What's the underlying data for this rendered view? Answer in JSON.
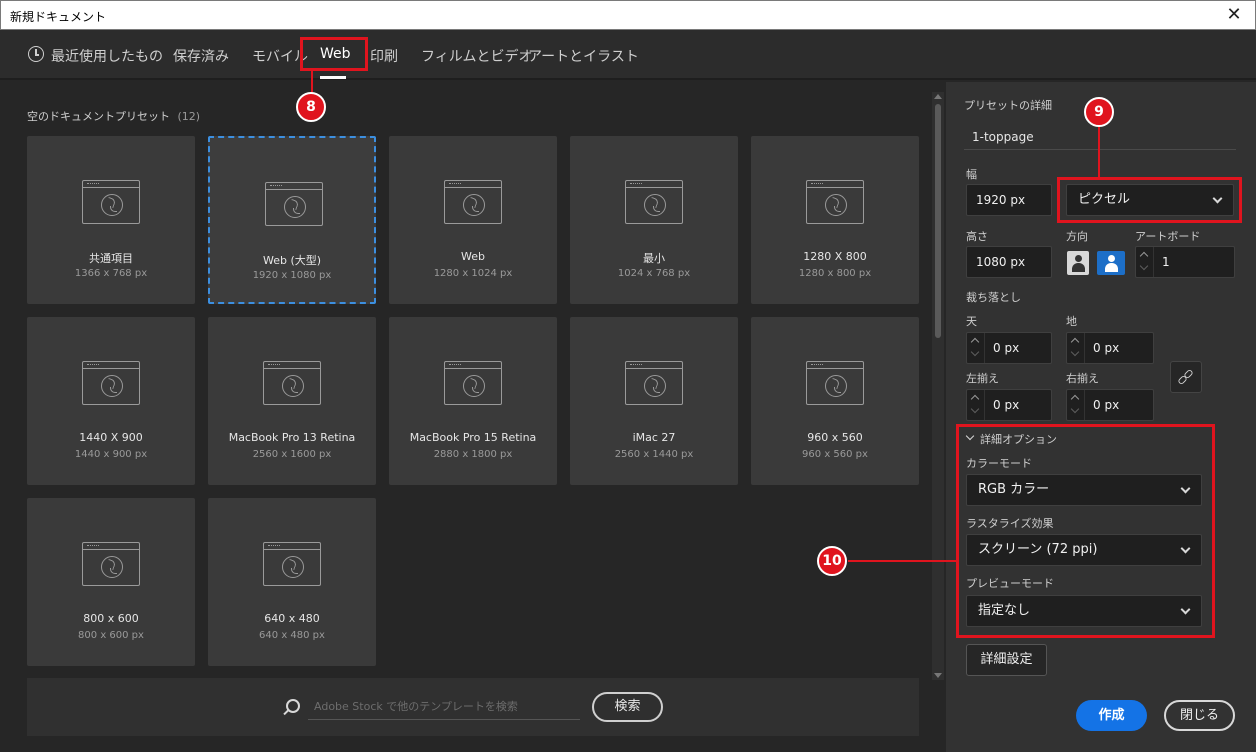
{
  "window": {
    "title": "新規ドキュメント",
    "close_glyph": "✕"
  },
  "tabs": [
    {
      "label": "最近使用したもの"
    },
    {
      "label": "保存済み"
    },
    {
      "label": "モバイル"
    },
    {
      "label": "Web"
    },
    {
      "label": "印刷"
    },
    {
      "label": "フィルムとビデオ"
    },
    {
      "label": "アートとイラスト"
    }
  ],
  "active_tab": "Web",
  "presets": {
    "heading": "空のドキュメントプリセット",
    "count": "(12)",
    "selected": "Web (大型)",
    "items": [
      {
        "name": "共通項目",
        "size": "1366 x 768 px"
      },
      {
        "name": "Web (大型)",
        "size": "1920 x 1080 px"
      },
      {
        "name": "Web",
        "size": "1280 x 1024 px"
      },
      {
        "name": "最小",
        "size": "1024 x 768 px"
      },
      {
        "name": "1280 X 800",
        "size": "1280 x 800 px"
      },
      {
        "name": "1440 X 900",
        "size": "1440 x 900 px"
      },
      {
        "name": "MacBook Pro 13 Retina",
        "size": "2560 x 1600 px"
      },
      {
        "name": "MacBook Pro 15 Retina",
        "size": "2880 x 1800 px"
      },
      {
        "name": "iMac 27",
        "size": "2560 x 1440 px"
      },
      {
        "name": "960 x 560",
        "size": "960 x 560 px"
      },
      {
        "name": "800 x 600",
        "size": "800 x 600 px"
      },
      {
        "name": "640 x 480",
        "size": "640 x 480 px"
      }
    ]
  },
  "search": {
    "placeholder": "Adobe Stock で他のテンプレートを検索",
    "button": "検索"
  },
  "details": {
    "heading": "プリセットの詳細",
    "preset_name": "1-toppage",
    "width_label": "幅",
    "width_value": "1920 px",
    "unit": "ピクセル",
    "height_label": "高さ",
    "height_value": "1080 px",
    "orientation_label": "方向",
    "orientation_selected": "landscape",
    "artboard_label": "アートボード",
    "artboard_value": "1",
    "bleed_label": "裁ち落とし",
    "bleed_top_label": "天",
    "bleed_top": "0 px",
    "bleed_bottom_label": "地",
    "bleed_bottom": "0 px",
    "bleed_left_label": "左揃え",
    "bleed_left": "0 px",
    "bleed_right_label": "右揃え",
    "bleed_right": "0 px",
    "advanced_label": "詳細オプション",
    "color_mode_label": "カラーモード",
    "color_mode": "RGB カラー",
    "raster_label": "ラスタライズ効果",
    "raster": "スクリーン (72 ppi)",
    "preview_label": "プレビューモード",
    "preview": "指定なし",
    "more_settings": "詳細設定",
    "create": "作成",
    "close": "閉じる"
  },
  "annotations": {
    "m8": "8",
    "m9": "9",
    "m10": "10"
  },
  "colors": {
    "accent": "#1473e6",
    "annotation_red": "#e0141e",
    "selection_border": "#3c8fe0",
    "panel_bg": "#323232",
    "grid_bg": "#262626"
  }
}
